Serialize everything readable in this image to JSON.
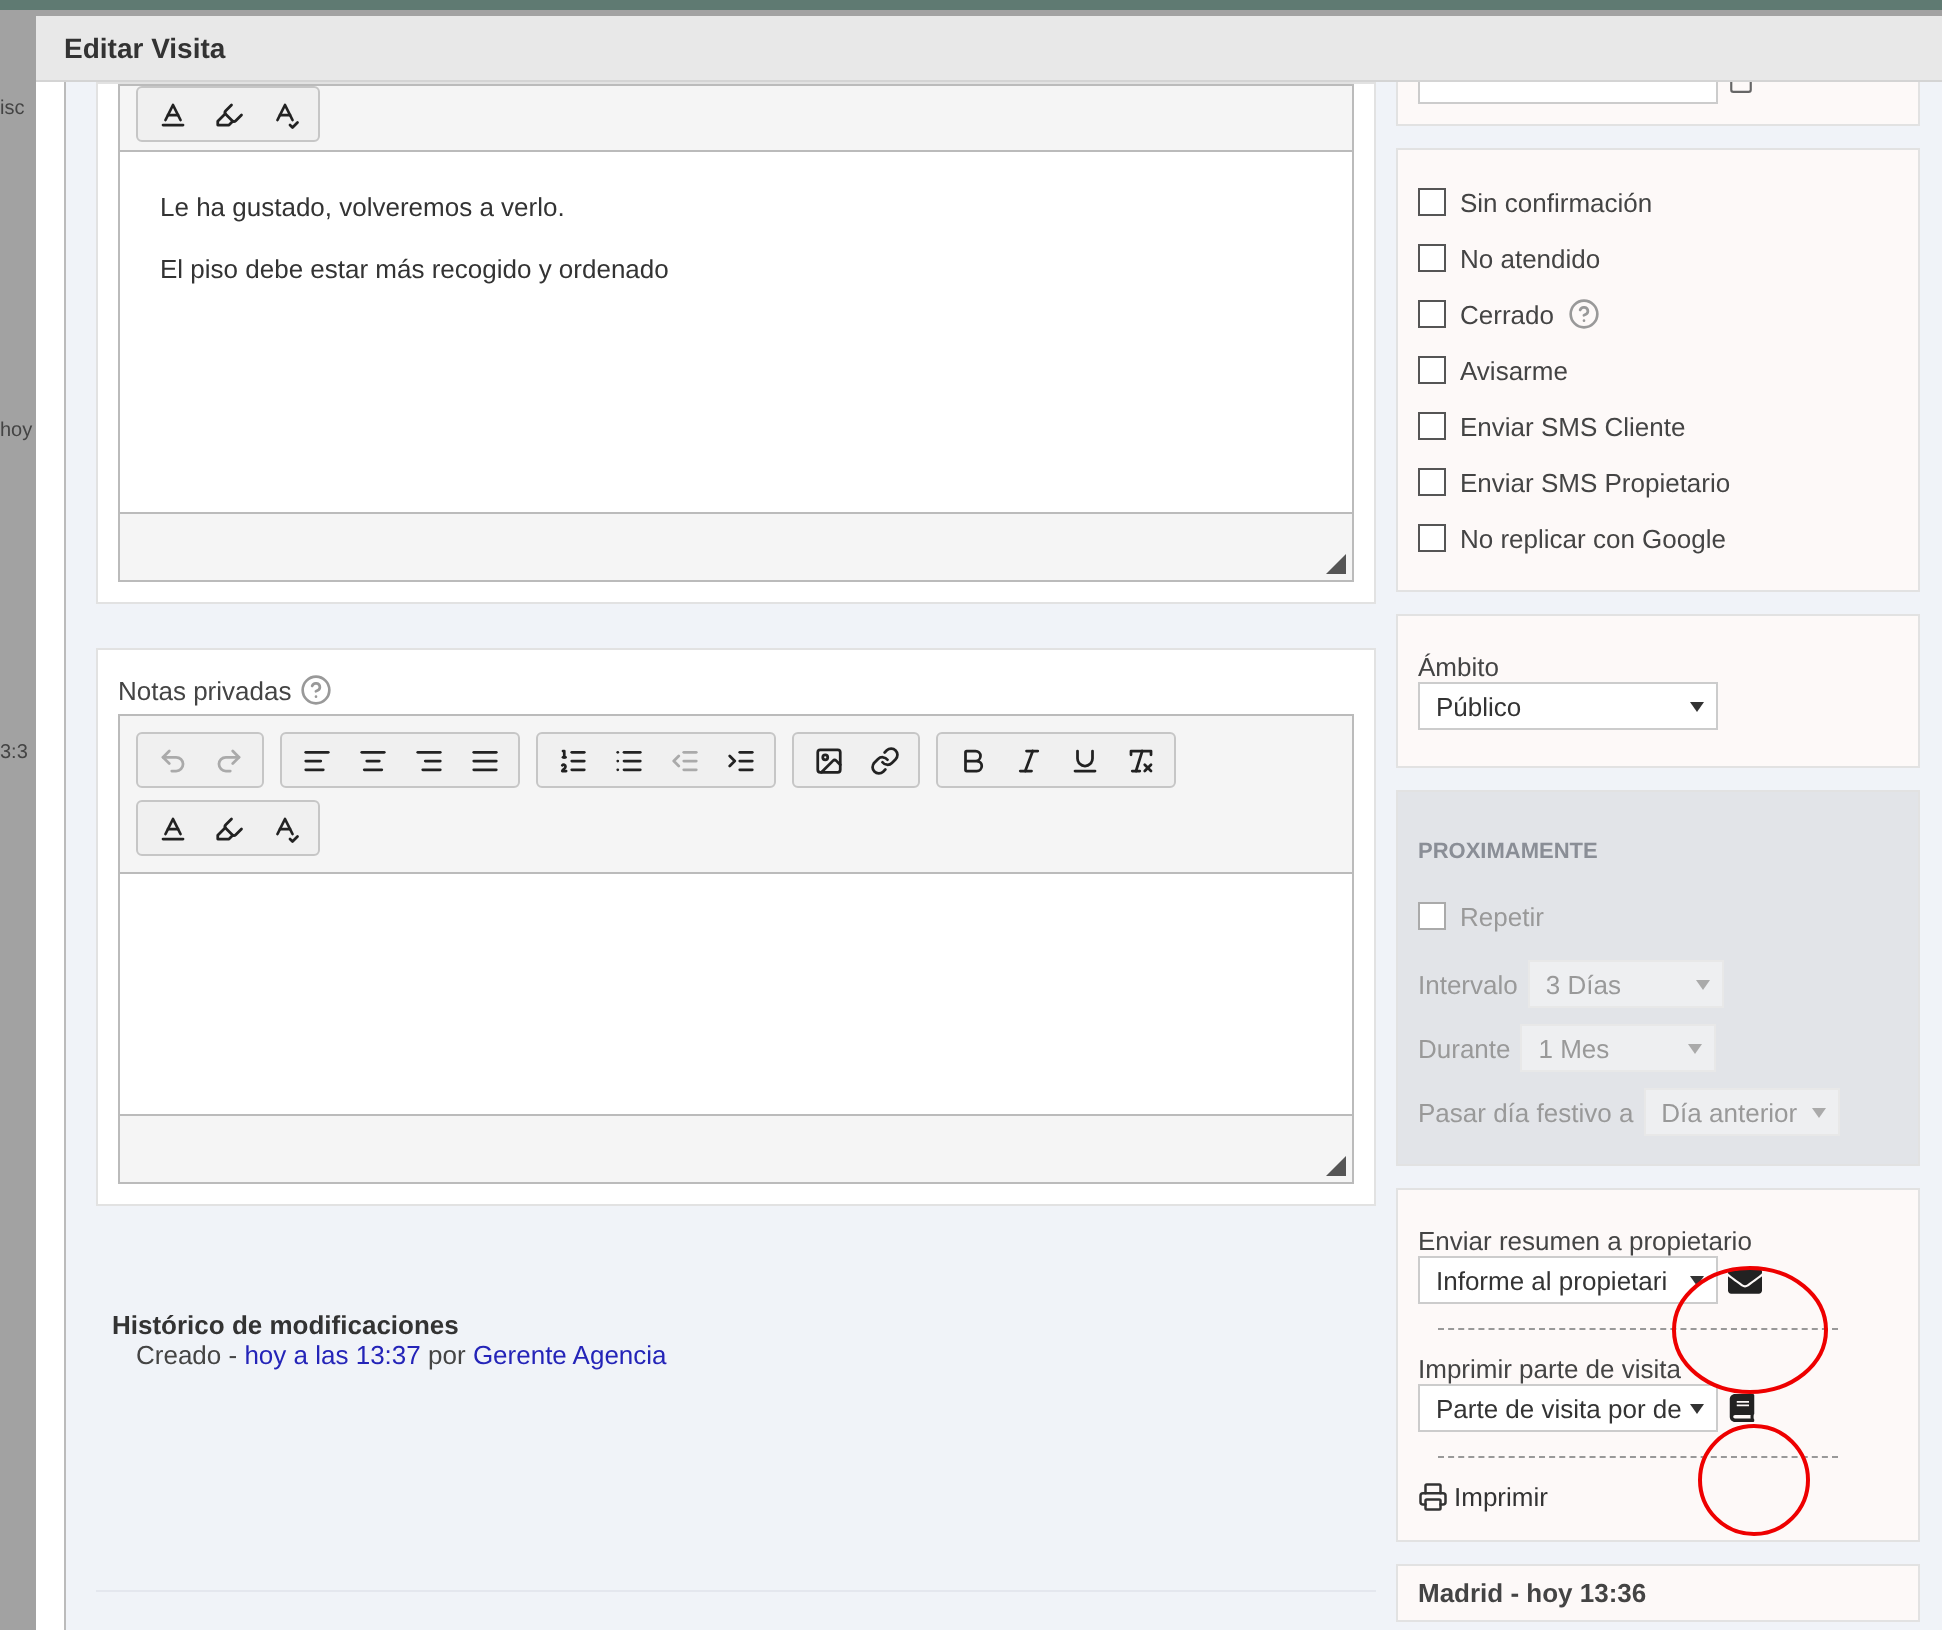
{
  "window": {
    "title": "Editar Visita"
  },
  "background_fragments": [
    "isc",
    "hoy",
    "3:3"
  ],
  "public_notes": {
    "paragraphs": [
      "Le ha gustado, volveremos a verlo.",
      "El piso debe estar más recogido y ordenado"
    ]
  },
  "private_notes": {
    "label": "Notas privadas",
    "history_buttons_enabled": false
  },
  "history": {
    "title": "Histórico de modificaciones",
    "entries": [
      {
        "action": "Creado -",
        "when": "hoy a las 13:37",
        "by": "por",
        "author": "Gerente Agencia"
      }
    ]
  },
  "options": [
    {
      "label": "Sin confirmación",
      "checked": false,
      "help": false
    },
    {
      "label": "No atendido",
      "checked": false,
      "help": false
    },
    {
      "label": "Cerrado",
      "checked": false,
      "help": true
    },
    {
      "label": "Avisarme",
      "checked": false,
      "help": false
    },
    {
      "label": "Enviar SMS Cliente",
      "checked": false,
      "help": false
    },
    {
      "label": "Enviar SMS Propietario",
      "checked": false,
      "help": false
    },
    {
      "label": "No replicar con Google",
      "checked": false,
      "help": false
    }
  ],
  "scope": {
    "label": "Ámbito",
    "value": "Público"
  },
  "upcoming": {
    "title": "PROXIMAMENTE",
    "disabled": true,
    "repeat": {
      "label": "Repetir",
      "checked": false
    },
    "fields": [
      {
        "label": "Intervalo",
        "value": "3 Días"
      },
      {
        "label": "Durante",
        "value": "1 Mes"
      },
      {
        "label": "Pasar día festivo a",
        "value": "Día anterior"
      }
    ]
  },
  "owner_summary": {
    "label": "Enviar resumen a propietario",
    "value": "Informe al propietari"
  },
  "visit_report": {
    "label": "Imprimir parte de visita",
    "value": "Parte de visita por de"
  },
  "print": {
    "label": "Imprimir"
  },
  "footer_card": {
    "text": "Madrid - hoy 13:36"
  }
}
